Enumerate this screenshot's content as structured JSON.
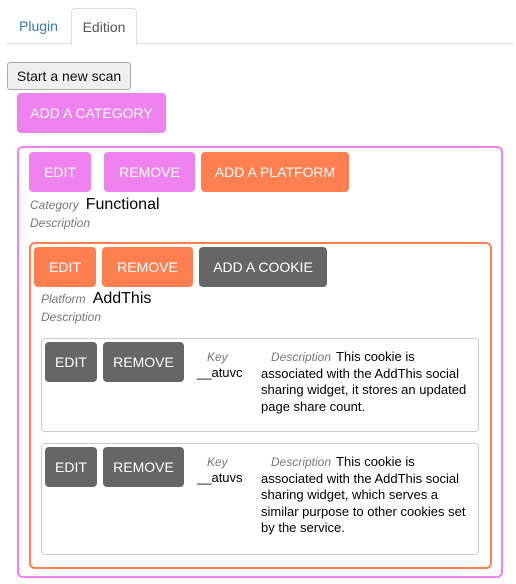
{
  "tabs": [
    {
      "label": "Plugin",
      "active": false
    },
    {
      "label": "Edition",
      "active": true
    }
  ],
  "toolbar": {
    "start_scan_label": "Start a new scan",
    "add_category_label": "ADD A CATEGORY"
  },
  "colors": {
    "category": "#ee82ee",
    "platform": "#ff7f50",
    "cookie": "#666666",
    "tab_link": "#337ab7"
  },
  "category": {
    "edit_label": "EDIT",
    "remove_label": "REMOVE",
    "add_platform_label": "ADD A PLATFORM",
    "name_label": "Category",
    "name": "Functional",
    "description_label": "Description",
    "platform": {
      "edit_label": "EDIT",
      "remove_label": "REMOVE",
      "add_cookie_label": "ADD A COOKIE",
      "name_label": "Platform",
      "name": "AddThis",
      "description_label": "Description",
      "cookies": [
        {
          "edit_label": "EDIT",
          "remove_label": "REMOVE",
          "key_label": "Key",
          "key": "__atuvc",
          "description_label": "Description",
          "description": "This cookie is associated with the AddThis social sharing widget, it stores an updated page share count."
        },
        {
          "edit_label": "EDIT",
          "remove_label": "REMOVE",
          "key_label": "Key",
          "key": "__atuvs",
          "description_label": "Description",
          "description": "This cookie is associated with the AddThis social sharing widget, which serves a similar purpose to other cookies set by the service."
        }
      ]
    }
  }
}
